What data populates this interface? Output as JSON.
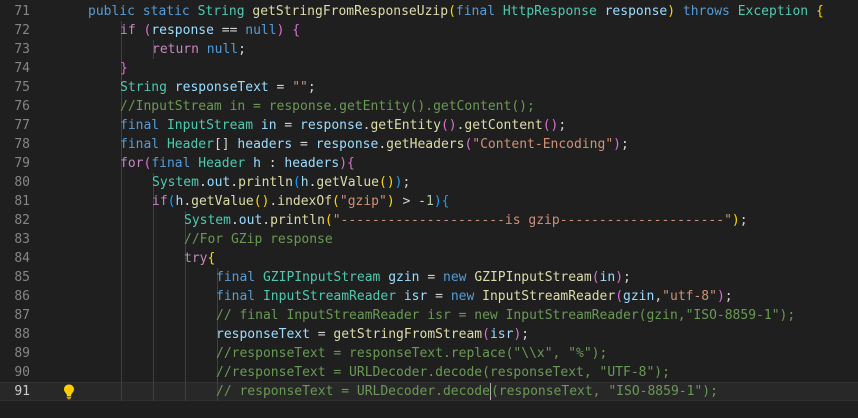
{
  "editor": {
    "current_line": 91,
    "lines": [
      {
        "n": "71",
        "indent": 0,
        "tokens": [
          [
            "kw",
            "public "
          ],
          [
            "kw",
            "static "
          ],
          [
            "type",
            "String "
          ],
          [
            "fn",
            "getStringFromResponseUzip"
          ],
          [
            "brk",
            "("
          ],
          [
            "kw",
            "final "
          ],
          [
            "type",
            "HttpResponse "
          ],
          [
            "var",
            "response"
          ],
          [
            "brk",
            ")"
          ],
          [
            "pun",
            " "
          ],
          [
            "kw",
            "throws "
          ],
          [
            "type",
            "Exception "
          ],
          [
            "brk",
            "{"
          ]
        ]
      },
      {
        "n": "72",
        "indent": 1,
        "tokens": [
          [
            "ctl",
            "if "
          ],
          [
            "brk2",
            "("
          ],
          [
            "var",
            "response "
          ],
          [
            "pun",
            "== "
          ],
          [
            "kw",
            "null"
          ],
          [
            "brk2",
            ")"
          ],
          [
            "pun",
            " "
          ],
          [
            "brk2",
            "{"
          ]
        ]
      },
      {
        "n": "73",
        "indent": 2,
        "tokens": [
          [
            "ctl",
            "return "
          ],
          [
            "kw",
            "null"
          ],
          [
            "pun",
            ";"
          ]
        ]
      },
      {
        "n": "74",
        "indent": 1,
        "tokens": [
          [
            "brk2",
            "}"
          ]
        ]
      },
      {
        "n": "75",
        "indent": 1,
        "tokens": [
          [
            "type",
            "String "
          ],
          [
            "var",
            "responseText "
          ],
          [
            "pun",
            "= "
          ],
          [
            "str",
            "\"\""
          ],
          [
            "pun",
            ";"
          ]
        ]
      },
      {
        "n": "76",
        "indent": 1,
        "tokens": [
          [
            "com",
            "//InputStream in = response.getEntity().getContent();"
          ]
        ]
      },
      {
        "n": "77",
        "indent": 1,
        "tokens": [
          [
            "kw",
            "final "
          ],
          [
            "type",
            "InputStream "
          ],
          [
            "var",
            "in "
          ],
          [
            "pun",
            "= "
          ],
          [
            "var",
            "response"
          ],
          [
            "pun",
            "."
          ],
          [
            "fn",
            "getEntity"
          ],
          [
            "brk2",
            "()"
          ],
          [
            "pun",
            "."
          ],
          [
            "fn",
            "getContent"
          ],
          [
            "brk2",
            "()"
          ],
          [
            "pun",
            ";"
          ]
        ]
      },
      {
        "n": "78",
        "indent": 1,
        "tokens": [
          [
            "kw",
            "final "
          ],
          [
            "type",
            "Header"
          ],
          [
            "pun",
            "[] "
          ],
          [
            "var",
            "headers "
          ],
          [
            "pun",
            "= "
          ],
          [
            "var",
            "response"
          ],
          [
            "pun",
            "."
          ],
          [
            "fn",
            "getHeaders"
          ],
          [
            "brk2",
            "("
          ],
          [
            "str",
            "\"Content-Encoding\""
          ],
          [
            "brk2",
            ")"
          ],
          [
            "pun",
            ";"
          ]
        ]
      },
      {
        "n": "79",
        "indent": 1,
        "tokens": [
          [
            "ctl",
            "for"
          ],
          [
            "brk2",
            "("
          ],
          [
            "kw",
            "final "
          ],
          [
            "type",
            "Header "
          ],
          [
            "var",
            "h "
          ],
          [
            "pun",
            ": "
          ],
          [
            "var",
            "headers"
          ],
          [
            "brk2",
            ")"
          ],
          [
            "brk2",
            "{"
          ]
        ]
      },
      {
        "n": "80",
        "indent": 2,
        "tokens": [
          [
            "type",
            "System"
          ],
          [
            "pun",
            "."
          ],
          [
            "var",
            "out"
          ],
          [
            "pun",
            "."
          ],
          [
            "fn",
            "println"
          ],
          [
            "brk3",
            "("
          ],
          [
            "var",
            "h"
          ],
          [
            "pun",
            "."
          ],
          [
            "fn",
            "getValue"
          ],
          [
            "brk",
            "()"
          ],
          [
            "brk3",
            ")"
          ],
          [
            "pun",
            ";"
          ]
        ]
      },
      {
        "n": "81",
        "indent": 2,
        "tokens": [
          [
            "ctl",
            "if"
          ],
          [
            "brk3",
            "("
          ],
          [
            "var",
            "h"
          ],
          [
            "pun",
            "."
          ],
          [
            "fn",
            "getValue"
          ],
          [
            "brk",
            "()"
          ],
          [
            "pun",
            "."
          ],
          [
            "fn",
            "indexOf"
          ],
          [
            "brk",
            "("
          ],
          [
            "str",
            "\"gzip\""
          ],
          [
            "brk",
            ")"
          ],
          [
            "pun",
            " > -"
          ],
          [
            "num",
            "1"
          ],
          [
            "brk3",
            ")"
          ],
          [
            "brk3",
            "{"
          ]
        ]
      },
      {
        "n": "82",
        "indent": 3,
        "tokens": [
          [
            "type",
            "System"
          ],
          [
            "pun",
            "."
          ],
          [
            "var",
            "out"
          ],
          [
            "pun",
            "."
          ],
          [
            "fn",
            "println"
          ],
          [
            "brk",
            "("
          ],
          [
            "str",
            "\"---------------------is gzip---------------------\""
          ],
          [
            "brk",
            ")"
          ],
          [
            "pun",
            ";"
          ]
        ]
      },
      {
        "n": "83",
        "indent": 3,
        "tokens": [
          [
            "com",
            "//For GZip response"
          ]
        ]
      },
      {
        "n": "84",
        "indent": 3,
        "tokens": [
          [
            "ctl",
            "try"
          ],
          [
            "brk",
            "{"
          ]
        ]
      },
      {
        "n": "85",
        "indent": 4,
        "tokens": [
          [
            "kw",
            "final "
          ],
          [
            "type",
            "GZIPInputStream "
          ],
          [
            "var",
            "gzin "
          ],
          [
            "pun",
            "= "
          ],
          [
            "kw",
            "new "
          ],
          [
            "fn",
            "GZIPInputStream"
          ],
          [
            "brk2",
            "("
          ],
          [
            "var",
            "in"
          ],
          [
            "brk2",
            ")"
          ],
          [
            "pun",
            ";"
          ]
        ]
      },
      {
        "n": "86",
        "indent": 4,
        "tokens": [
          [
            "kw",
            "final "
          ],
          [
            "type",
            "InputStreamReader "
          ],
          [
            "var",
            "isr "
          ],
          [
            "pun",
            "= "
          ],
          [
            "kw",
            "new "
          ],
          [
            "fn",
            "InputStreamReader"
          ],
          [
            "brk2",
            "("
          ],
          [
            "var",
            "gzin"
          ],
          [
            "pun",
            ","
          ],
          [
            "str",
            "\"utf-8\""
          ],
          [
            "brk2",
            ")"
          ],
          [
            "pun",
            ";"
          ]
        ]
      },
      {
        "n": "87",
        "indent": 4,
        "tokens": [
          [
            "com",
            "// final InputStreamReader isr = new InputStreamReader(gzin,\"ISO-8859-1\");"
          ]
        ]
      },
      {
        "n": "88",
        "indent": 4,
        "tokens": [
          [
            "var",
            "responseText "
          ],
          [
            "pun",
            "= "
          ],
          [
            "fn",
            "getStringFromStream"
          ],
          [
            "brk2",
            "("
          ],
          [
            "var",
            "isr"
          ],
          [
            "brk2",
            ")"
          ],
          [
            "pun",
            ";"
          ]
        ]
      },
      {
        "n": "89",
        "indent": 4,
        "tokens": [
          [
            "com",
            "//responseText = responseText.replace(\"\\\\x\", \"%\");"
          ]
        ]
      },
      {
        "n": "90",
        "indent": 4,
        "tokens": [
          [
            "com",
            "//responseText = URLDecoder.decode(responseText, \"UTF-8\");"
          ]
        ]
      },
      {
        "n": "91",
        "indent": 4,
        "tokens": [
          [
            "com",
            "// responseText = URLDecoder.decode"
          ],
          [
            "cursor",
            ""
          ],
          [
            "com",
            "(responseText, \"ISO-8859-1\");"
          ]
        ]
      }
    ]
  },
  "icons": {
    "lightbulb": "lightbulb-icon"
  }
}
